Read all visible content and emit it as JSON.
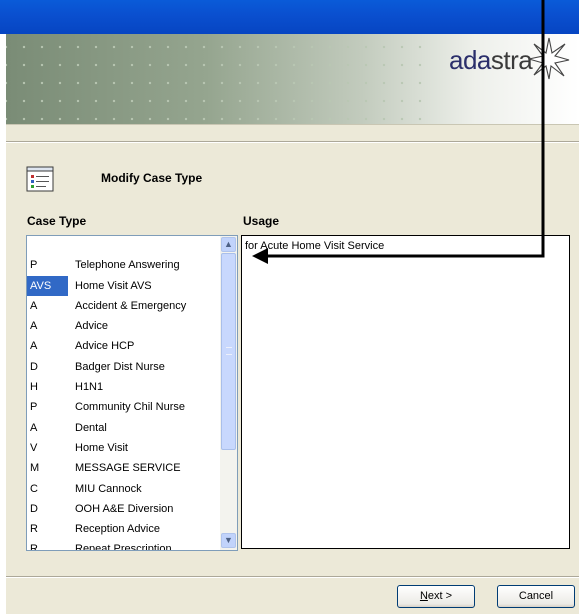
{
  "brand": {
    "name_part1": "ada",
    "name_part2": "stra"
  },
  "page": {
    "heading": "Modify Case Type"
  },
  "labels": {
    "case_type": "Case Type",
    "usage": "Usage"
  },
  "case_types": [
    {
      "code": "",
      "name": ""
    },
    {
      "code": "P",
      "name": "Telephone Answering"
    },
    {
      "code": "AVS",
      "name": "Home Visit AVS",
      "selected": true
    },
    {
      "code": "A",
      "name": "Accident & Emergency"
    },
    {
      "code": "A",
      "name": "Advice"
    },
    {
      "code": "A",
      "name": "Advice HCP"
    },
    {
      "code": "D",
      "name": "Badger Dist Nurse"
    },
    {
      "code": "H",
      "name": "H1N1"
    },
    {
      "code": "P",
      "name": "Community Chil Nurse"
    },
    {
      "code": "A",
      "name": "Dental"
    },
    {
      "code": "V",
      "name": "Home Visit"
    },
    {
      "code": "M",
      "name": "MESSAGE SERVICE"
    },
    {
      "code": "C",
      "name": "MIU Cannock"
    },
    {
      "code": "D",
      "name": "OOH A&E Diversion"
    },
    {
      "code": "R",
      "name": "Reception Advice"
    },
    {
      "code": "R",
      "name": "Repeat Prescription"
    }
  ],
  "usage": {
    "text": "for Acute Home Visit Service"
  },
  "buttons": {
    "next": "Next >",
    "next_mnemonic": "N",
    "next_rest": "ext >",
    "cancel": "Cancel"
  },
  "colors": {
    "titlebar": "#0a4fcf",
    "selection": "#3169c6",
    "brand": "#2b2f6b"
  }
}
